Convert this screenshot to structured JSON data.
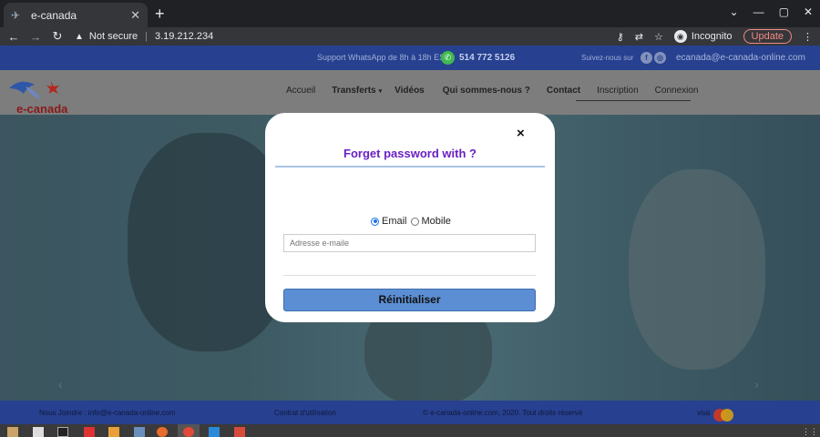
{
  "browser": {
    "tab_title": "e-canada",
    "new_tab": "+",
    "security": "Not secure",
    "url": "3.19.212.234",
    "incognito_label": "Incognito",
    "update_label": "Update"
  },
  "topstrip": {
    "support": "Support WhatsApp de 8h à 18h EST",
    "phone": "514 772 5126",
    "follow": "Suivez-nous sur",
    "email": "ecanada@e-canada-online.com"
  },
  "logo": {
    "text": "e-canada"
  },
  "menu": {
    "items": [
      "Accueil",
      "Transferts",
      "Vidéos",
      "Qui sommes-nous ?",
      "Contact",
      "Inscription",
      "Connexion"
    ]
  },
  "modal": {
    "close": "×",
    "title": "Forget password with ?",
    "option_email": "Email",
    "option_mobile": "Mobile",
    "selected": "Email",
    "email_placeholder": "Adresse e-maile",
    "submit_label": "Réinitialiser"
  },
  "footer": {
    "contact": "Nous Joindre : info@e-canada-online.com",
    "terms": "Contrat d'utilisation",
    "copyright": "© e-canada-online.com, 2020. Tout droits réservé",
    "visa": "visa"
  },
  "colors": {
    "brand_blue": "#27408f",
    "modal_title": "#6a1fc4",
    "submit_bg": "#5b8ed2",
    "logo_red": "#8a1a1a"
  }
}
